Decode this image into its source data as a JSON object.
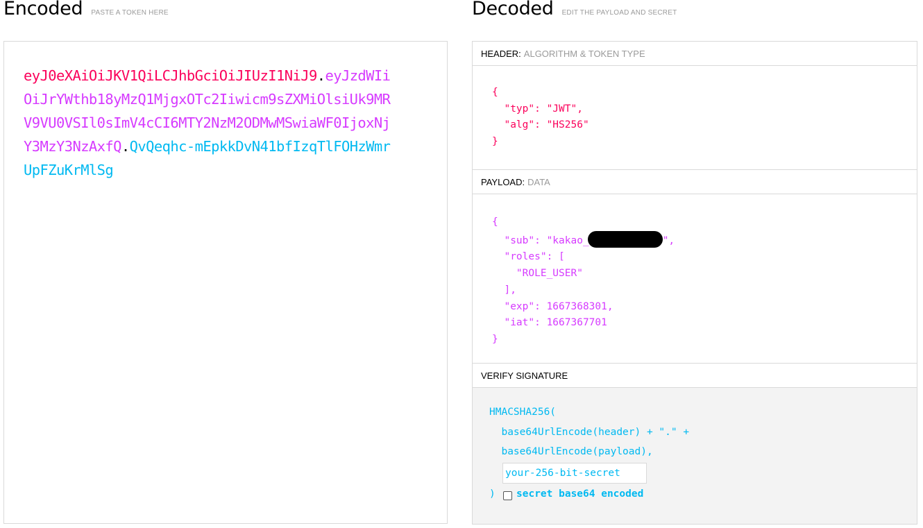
{
  "encoded": {
    "title": "Encoded",
    "subtitle": "PASTE A TOKEN HERE",
    "token": {
      "header": "eyJ0eXAiOiJKV1QiLCJhbGciOiJIUzI1NiJ9",
      "payload": "eyJzdWIiOiJrYWthb18yMzQ1MjgxOTc2Iiwicm9sZXMiOlsiUk9MRV9VU0VSIl0sImV4cCI6MTY2NzM2ODMwMSwiaWF0IjoxNjY3MzY3NzAxfQ",
      "signature": "QvQeqhc-mEpkkDvN41bfIzqTlFOHzWmrUpFZuKrMlSg",
      "dot": "."
    }
  },
  "decoded": {
    "title": "Decoded",
    "subtitle": "EDIT THE PAYLOAD AND SECRET",
    "header_section": {
      "label": "HEADER:",
      "sub": "ALGORITHM & TOKEN TYPE",
      "lines": [
        "{",
        "  \"typ\": \"JWT\",",
        "  \"alg\": \"HS256\"",
        "}"
      ]
    },
    "payload_section": {
      "label": "PAYLOAD:",
      "sub": "DATA",
      "line_open": "{",
      "sub_prefix": "  \"sub\": \"kakao_",
      "sub_suffix": "\",",
      "lines_after": [
        "  \"roles\": [",
        "    \"ROLE_USER\"",
        "  ],",
        "  \"exp\": 1667368301,",
        "  \"iat\": 1667367701",
        "}"
      ]
    },
    "verify_section": {
      "label": "VERIFY SIGNATURE",
      "line1": "HMACSHA256(",
      "line2": "  base64UrlEncode(header) + \".\" +",
      "line3": "  base64UrlEncode(payload),",
      "secret_placeholder": "your-256-bit-secret",
      "close": ")",
      "checkbox_label": "secret base64 encoded",
      "checkbox_checked": false
    }
  },
  "colors": {
    "header": "#fb015b",
    "payload": "#d63aff",
    "signature": "#00b9f1"
  }
}
